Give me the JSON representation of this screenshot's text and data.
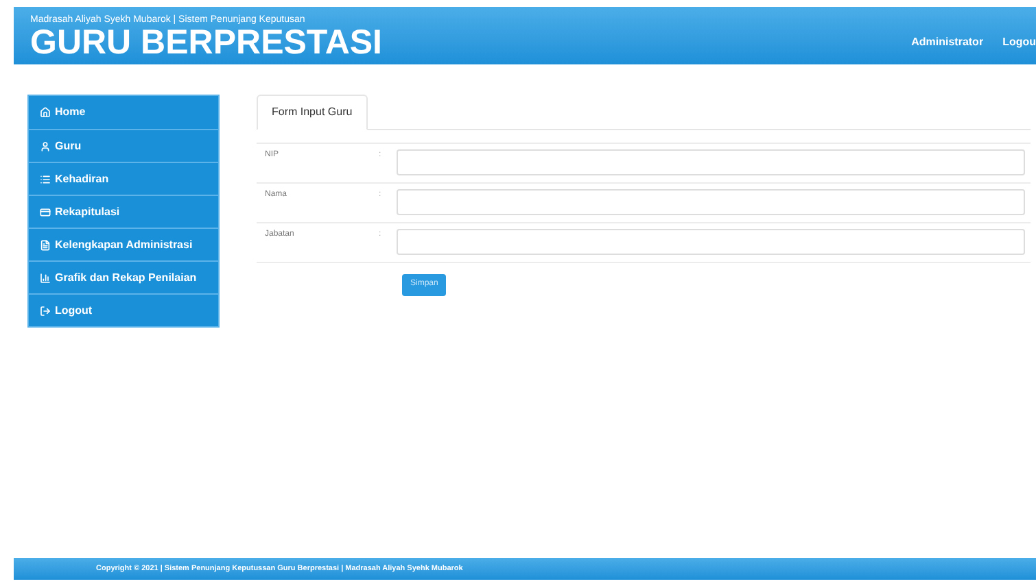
{
  "header": {
    "subtitle": "Madrasah Aliyah Syekh Mubarok | Sistem Penunjang Keputusan",
    "title": "GURU BERPRESTASI",
    "nav": [
      "Administrator",
      "Logou"
    ]
  },
  "sidebar": {
    "items": [
      {
        "label": "Home",
        "kind": "home"
      },
      {
        "label": "Guru",
        "kind": "user"
      },
      {
        "label": "Kehadiran",
        "kind": "list"
      },
      {
        "label": "Rekapitulasi",
        "kind": "card"
      },
      {
        "label": "Kelengkapan Administrasi",
        "kind": "file"
      },
      {
        "label": "Grafik dan Rekap Penilaian",
        "kind": "chart"
      },
      {
        "label": "Logout",
        "kind": "logout"
      }
    ]
  },
  "tabs": [
    {
      "label": "Form Input Guru",
      "selected": true
    }
  ],
  "form": {
    "fields": [
      {
        "label": "NIP",
        "separator": ":"
      },
      {
        "label": "Nama",
        "separator": ":"
      },
      {
        "label": "Jabatan",
        "separator": ":"
      }
    ],
    "submit": "Simpan"
  },
  "footer": "Copyright © 2021 | Sistem Penunjang Keputussan Guru Berprestasi | Madrasah Aliyah Syehk Mubarok"
}
